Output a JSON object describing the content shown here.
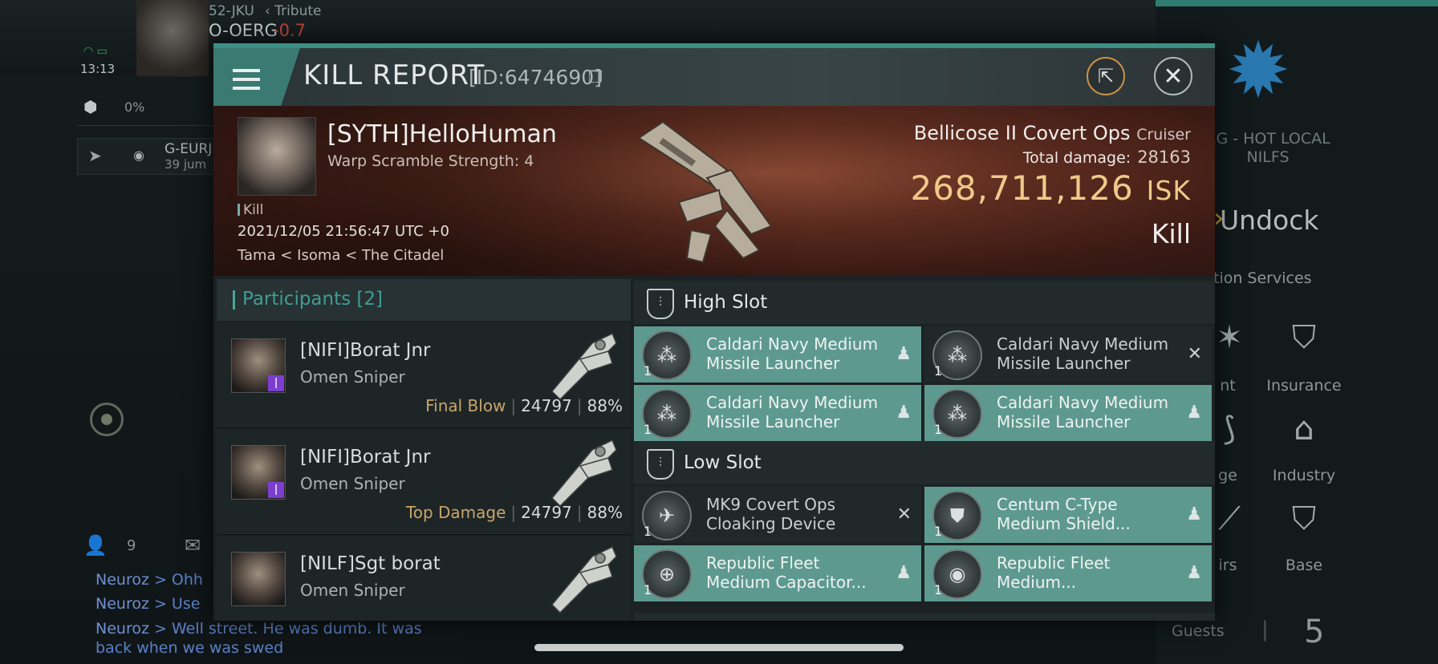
{
  "background": {
    "system_top": "52-JKU",
    "tribute": "Tribute",
    "system_current": "O-OERG",
    "security": "-0.7",
    "time": "13:13",
    "cargo_pct": "0%",
    "route_name": "G-EURJ",
    "route_jumps": "39 jum",
    "people_count": "9",
    "chat": [
      {
        "name": "Neuroz",
        "text": " > Ohh"
      },
      {
        "name": "Neuroz",
        "text": " > Use"
      },
      {
        "name": "Neuroz",
        "text": " > Well street. He was dumb. It was"
      },
      {
        "name": "",
        "text": "back when we was swed"
      }
    ],
    "corp_name_line1": "RG - HOT LOCAL",
    "corp_name_line2": "NILFS",
    "undock_label": "Undock",
    "station_services_label": "tion Services",
    "services": [
      {
        "icon": "star-icon",
        "label": "nt"
      },
      {
        "icon": "insurance-icon",
        "label": "Insurance"
      },
      {
        "icon": "repair-icon",
        "label": "ge"
      },
      {
        "icon": "industry-icon",
        "label": "Industry"
      },
      {
        "icon": "wrench-icon",
        "label": "irs"
      },
      {
        "icon": "base-icon",
        "label": "Base"
      }
    ],
    "guests_label": "Guests",
    "guests_count": "5"
  },
  "modal": {
    "title": "KILL REPORT",
    "id_label": "[ID:6474690]",
    "victim": {
      "name": "[SYTH]HelloHuman",
      "sub": "Warp Scramble Strength: 4",
      "tag": "Kill",
      "datetime": "2021/12/05 21:56:47 UTC +0",
      "location": "Tama < Isoma < The Citadel"
    },
    "ship": {
      "name": "Bellicose II Covert Ops",
      "class": "Cruiser",
      "total_damage_label": "Total damage:",
      "total_damage": "28163",
      "isk_value": "268,711,126",
      "isk_unit": "ISK",
      "result": "Kill"
    },
    "participants_title": "Participants [2]",
    "participants": [
      {
        "name": "[NIFI]Borat Jnr",
        "ship": "Omen Sniper",
        "label": "Final Blow",
        "damage": "24797",
        "pct": "88%"
      },
      {
        "name": "[NIFI]Borat Jnr",
        "ship": "Omen Sniper",
        "label": "Top Damage",
        "damage": "24797",
        "pct": "88%"
      },
      {
        "name": "[NILF]Sgt borat",
        "ship": "Omen Sniper",
        "label": "",
        "damage": "",
        "pct": ""
      }
    ],
    "high_slot_title": "High Slot",
    "low_slot_title": "Low Slot",
    "high_slot": [
      {
        "name": "Caldari Navy Medium Missile Launcher",
        "qty": "1",
        "state": "fit"
      },
      {
        "name": "Caldari Navy Medium Missile Launcher",
        "qty": "1",
        "state": "off"
      },
      {
        "name": "Caldari Navy Medium Missile Launcher",
        "qty": "1",
        "state": "fit"
      },
      {
        "name": "Caldari Navy Medium Missile Launcher",
        "qty": "1",
        "state": "fit"
      }
    ],
    "low_slot": [
      {
        "name": "MK9 Covert Ops Cloaking Device",
        "qty": "1",
        "state": "off"
      },
      {
        "name": "Centum C-Type Medium Shield...",
        "qty": "1",
        "state": "fit"
      },
      {
        "name": "Republic Fleet Medium Capacitor...",
        "qty": "1",
        "state": "fit"
      },
      {
        "name": "Republic Fleet Medium...",
        "qty": "1",
        "state": "fit"
      }
    ]
  }
}
